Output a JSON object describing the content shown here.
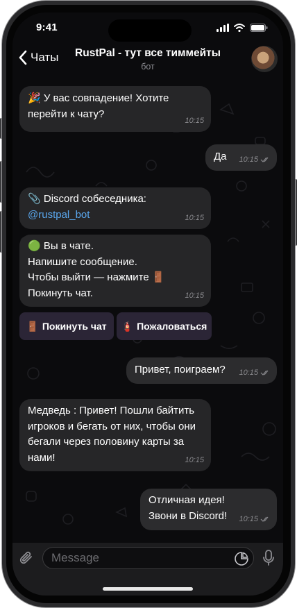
{
  "status_bar": {
    "time": "9:41"
  },
  "header": {
    "back_label": "Чаты",
    "title": "RustPal - тут все тиммейты",
    "subtitle": "бот"
  },
  "messages": [
    {
      "direction": "in",
      "emoji": "🎉",
      "text": "У вас совпадение! Хотите\nперейти к чату?",
      "time": "10:15"
    },
    {
      "direction": "out",
      "text": "Да",
      "time": "10:15",
      "read": true
    },
    {
      "direction": "in",
      "emoji": "📎",
      "text": "Discord собеседника:",
      "link": "@rustpal_bot",
      "time": "10:15"
    },
    {
      "direction": "in",
      "emoji": "🟢",
      "text": "Вы в чате.\nНапишите сообщение.\nЧтобы выйти — нажмите 🚪\nПокинуть чат.",
      "time": "10:15"
    },
    {
      "direction": "out",
      "text": "Привет, поиграем?",
      "time": "10:15",
      "read": true
    },
    {
      "direction": "in",
      "text": "Медведь : Привет! Пошли байтить\nигроков и бегать от них, чтобы они\nбегали через половину карты за\nнами!",
      "time": "10:15"
    },
    {
      "direction": "out",
      "text": "Отличная идея!\nЗвони в Discord!",
      "time": "10:15",
      "read": true
    }
  ],
  "keyboard": {
    "leave": {
      "emoji": "🚪",
      "label": "Покинуть чат"
    },
    "report": {
      "emoji": "🧯",
      "label": "Пожаловаться"
    }
  },
  "input": {
    "placeholder": "Message"
  },
  "icons": {
    "back": "chevron-left-icon",
    "attach": "paperclip-icon",
    "sticker": "sticker-icon",
    "mic": "microphone-icon",
    "read": "double-check-icon"
  },
  "colors": {
    "link": "#5aa7ee",
    "bubble": "#262628",
    "keyboard_button": "#2b2536"
  }
}
